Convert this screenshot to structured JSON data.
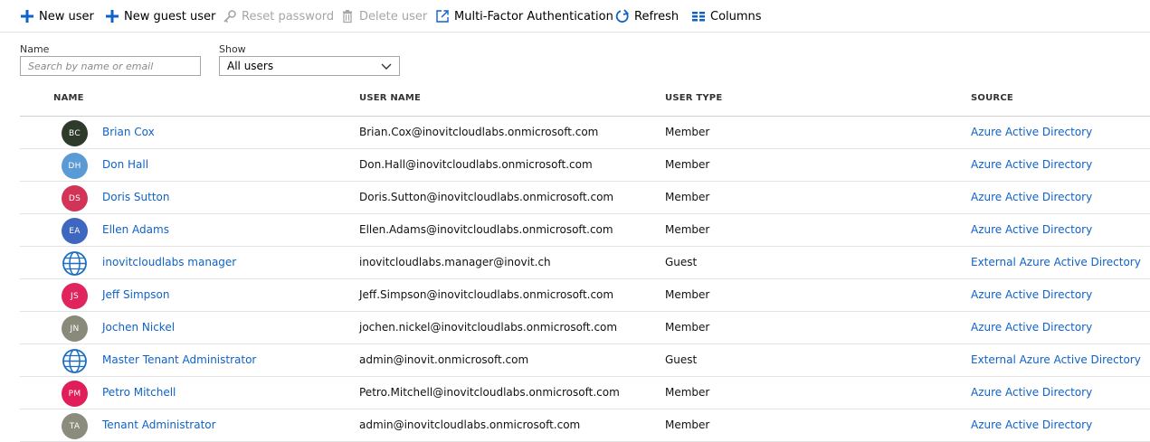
{
  "toolbar": {
    "new_user": "New user",
    "new_guest_user": "New guest user",
    "reset_password": "Reset password",
    "delete_user": "Delete user",
    "mfa": "Multi-Factor Authentication",
    "refresh": "Refresh",
    "columns": "Columns"
  },
  "filters": {
    "name_label": "Name",
    "name_placeholder": "Search by name or email",
    "show_label": "Show",
    "show_value": "All users"
  },
  "table": {
    "headers": {
      "name": "NAME",
      "username": "USER NAME",
      "usertype": "USER TYPE",
      "source": "SOURCE"
    },
    "rows": [
      {
        "initials": "BC",
        "avatar_color": "#2e3b2b",
        "globe": false,
        "name": "Brian Cox",
        "username": "Brian.Cox@inovitcloudlabs.onmicrosoft.com",
        "type": "Member",
        "source": "Azure Active Directory"
      },
      {
        "initials": "DH",
        "avatar_color": "#5b9bd5",
        "globe": false,
        "name": "Don Hall",
        "username": "Don.Hall@inovitcloudlabs.onmicrosoft.com",
        "type": "Member",
        "source": "Azure Active Directory"
      },
      {
        "initials": "DS",
        "avatar_color": "#d13456",
        "globe": false,
        "name": "Doris Sutton",
        "username": "Doris.Sutton@inovitcloudlabs.onmicrosoft.com",
        "type": "Member",
        "source": "Azure Active Directory"
      },
      {
        "initials": "EA",
        "avatar_color": "#3e68c0",
        "globe": false,
        "name": "Ellen Adams",
        "username": "Ellen.Adams@inovitcloudlabs.onmicrosoft.com",
        "type": "Member",
        "source": "Azure Active Directory"
      },
      {
        "initials": "",
        "avatar_color": "#1b6ec2",
        "globe": true,
        "name": "inovitcloudlabs manager",
        "username": "inovitcloudlabs.manager@inovit.ch",
        "type": "Guest",
        "source": "External Azure Active Directory"
      },
      {
        "initials": "JS",
        "avatar_color": "#e0245e",
        "globe": false,
        "name": "Jeff Simpson",
        "username": "Jeff.Simpson@inovitcloudlabs.onmicrosoft.com",
        "type": "Member",
        "source": "Azure Active Directory"
      },
      {
        "initials": "JN",
        "avatar_color": "#8a8a7a",
        "globe": false,
        "name": "Jochen Nickel",
        "username": "jochen.nickel@inovitcloudlabs.onmicrosoft.com",
        "type": "Member",
        "source": "Azure Active Directory"
      },
      {
        "initials": "",
        "avatar_color": "#1b6ec2",
        "globe": true,
        "name": "Master Tenant Administrator",
        "username": "admin@inovit.onmicrosoft.com",
        "type": "Guest",
        "source": "External Azure Active Directory"
      },
      {
        "initials": "PM",
        "avatar_color": "#e01e5a",
        "globe": false,
        "name": "Petro Mitchell",
        "username": "Petro.Mitchell@inovitcloudlabs.onmicrosoft.com",
        "type": "Member",
        "source": "Azure Active Directory"
      },
      {
        "initials": "TA",
        "avatar_color": "#8c8c7c",
        "globe": false,
        "name": "Tenant Administrator",
        "username": "admin@inovitcloudlabs.onmicrosoft.com",
        "type": "Member",
        "source": "Azure Active Directory"
      }
    ]
  }
}
